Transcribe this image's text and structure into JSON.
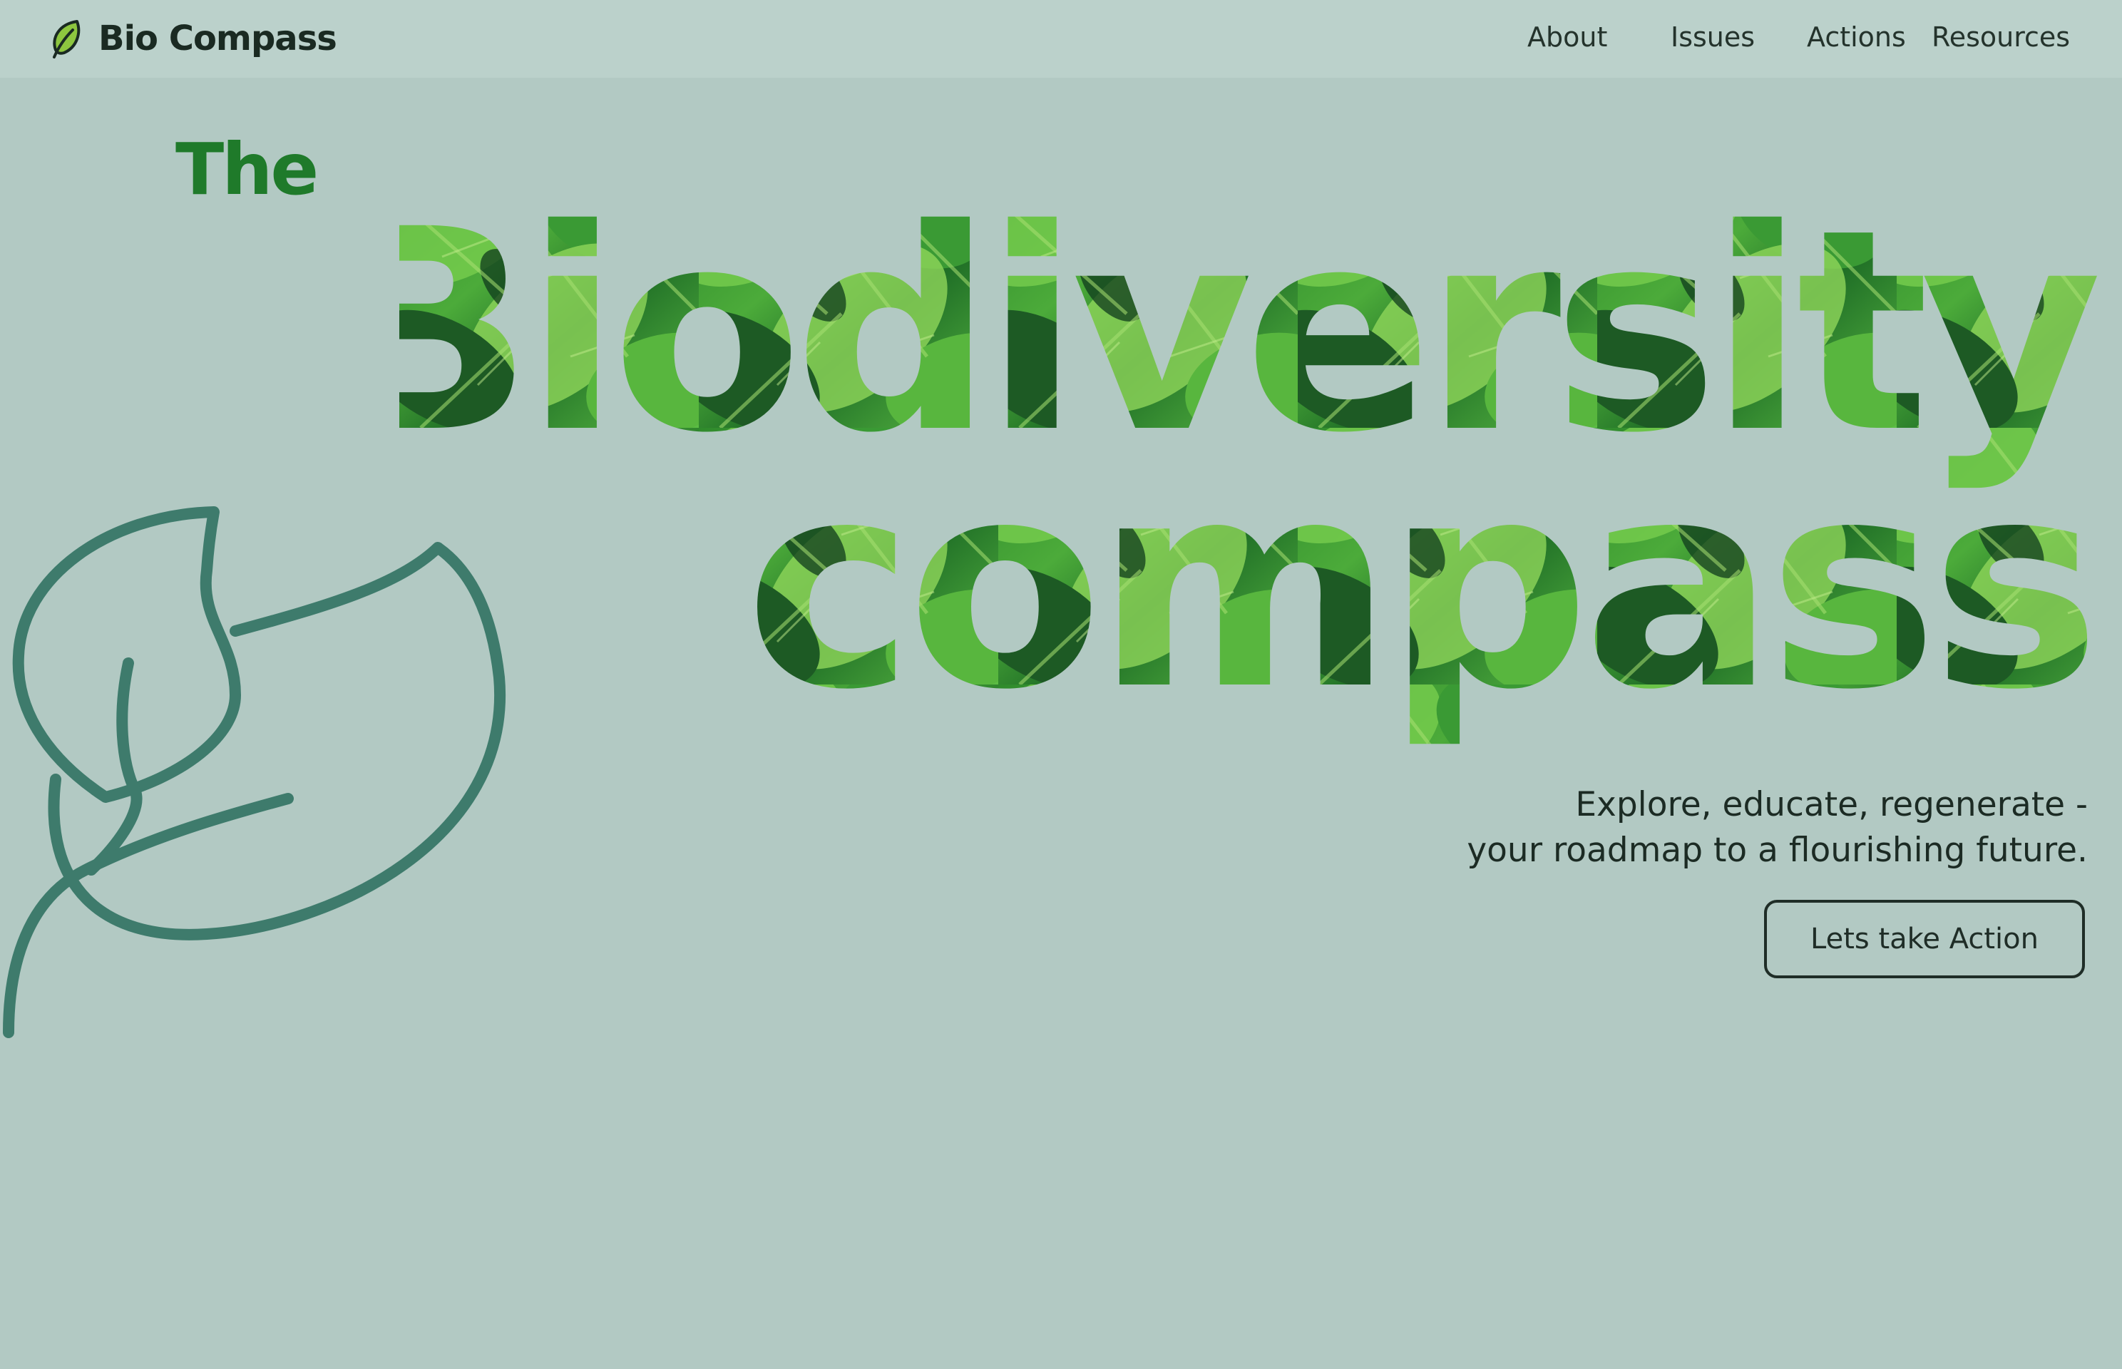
{
  "colors": {
    "background": "#b2c9c3",
    "header_background": "#bbd1cb",
    "text_dark": "#1f2d27",
    "leaf_outline": "#3e7b6c",
    "accent_green": "#1f7a2a",
    "logo_green": "#8dc63f"
  },
  "header": {
    "brand_icon": "leaf-icon",
    "brand_name": "Bio Compass",
    "nav": [
      {
        "label": "About"
      },
      {
        "label": "Issues"
      },
      {
        "label": "Actions"
      },
      {
        "label": "Resources"
      }
    ]
  },
  "hero": {
    "the_label": "The",
    "title_line1": "Biodiversity",
    "title_line2": "compass",
    "title_fill": "leaf-texture",
    "tagline_line1": "Explore, educate, regenerate -",
    "tagline_line2": "your roadmap to a flourishing future.",
    "cta_label": "Lets take Action",
    "illustration": "leaf-outline-illustration"
  }
}
